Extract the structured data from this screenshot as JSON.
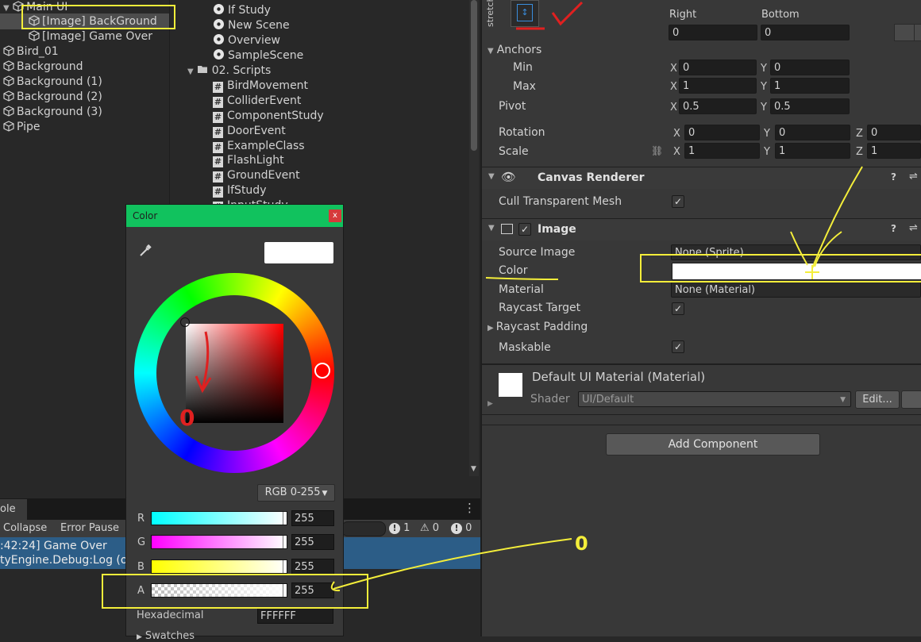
{
  "hierarchy": {
    "items": [
      {
        "label": "Main UI",
        "indent": 1
      },
      {
        "label": "[Image] BackGround",
        "indent": 2
      },
      {
        "label": "[Image] Game Over",
        "indent": 2
      },
      {
        "label": "Bird_01",
        "indent": 0
      },
      {
        "label": "Background",
        "indent": 0
      },
      {
        "label": "Background (1)",
        "indent": 0
      },
      {
        "label": "Background (2)",
        "indent": 0
      },
      {
        "label": "Background (3)",
        "indent": 0
      },
      {
        "label": "Pipe",
        "indent": 0
      }
    ]
  },
  "project": {
    "scenes": [
      "If Study",
      "New Scene",
      "Overview",
      "SampleScene"
    ],
    "scripts_folder": "02. Scripts",
    "scripts": [
      "BirdMovement",
      "ColliderEvent",
      "ComponentStudy",
      "DoorEvent",
      "ExampleClass",
      "FlashLight",
      "GroundEvent",
      "IfStudy",
      "InputStudy"
    ]
  },
  "console": {
    "tab": "ole",
    "collapse_label": "Collapse",
    "error_pause_label": "Error Pause",
    "counts": {
      "logs": "1",
      "warnings": "0",
      "errors": "0"
    },
    "entries": [
      {
        "line1": ":42:24] Game Over",
        "line2": "tyEngine.Debug:Log (ob"
      }
    ]
  },
  "color_picker": {
    "title": "Color",
    "close_label": "x",
    "mode": "RGB 0-255",
    "channels": [
      {
        "name": "R",
        "value": "255"
      },
      {
        "name": "G",
        "value": "255"
      },
      {
        "name": "B",
        "value": "255"
      },
      {
        "name": "A",
        "value": "255"
      }
    ],
    "hex_label": "Hexadecimal",
    "hex_value": "FFFFFF",
    "swatches_label": "Swatches",
    "preview_color": "#ffffff"
  },
  "inspector": {
    "stretch_label": "stretch",
    "right_label": "Right",
    "bottom_label": "Bottom",
    "right_value": "0",
    "bottom_value": "0",
    "anchors_label": "Anchors",
    "min_label": "Min",
    "max_label": "Max",
    "pivot_label": "Pivot",
    "rotation_label": "Rotation",
    "scale_label": "Scale",
    "x": "X",
    "y": "Y",
    "z": "Z",
    "anchors_min": {
      "x": "0",
      "y": "0"
    },
    "anchors_max": {
      "x": "1",
      "y": "1"
    },
    "pivot": {
      "x": "0.5",
      "y": "0.5"
    },
    "rotation": {
      "x": "0",
      "y": "0",
      "z": "0"
    },
    "scale": {
      "x": "1",
      "y": "1",
      "z": "1"
    },
    "canvas_renderer_title": "Canvas Renderer",
    "cull_label": "Cull Transparent Mesh",
    "image_title": "Image",
    "source_image_label": "Source Image",
    "source_image_value": "None (Sprite)",
    "color_label": "Color",
    "material_label": "Material",
    "material_value": "None (Material)",
    "raycast_target_label": "Raycast Target",
    "raycast_padding_label": "Raycast Padding",
    "maskable_label": "Maskable",
    "default_material_label": "Default UI Material (Material)",
    "shader_label": "Shader",
    "shader_value": "UI/Default",
    "edit_label": "Edit...",
    "add_component_label": "Add Component",
    "help_icon": "?",
    "check": "✓"
  },
  "annotations": {
    "zero_note": "0"
  },
  "colors": {
    "highlight_yellow": "#f4ee3a",
    "annotation_red": "#e02020",
    "picker_header": "#11c25e",
    "close_red": "#d63a3a",
    "console_selected": "#2c5d87"
  }
}
